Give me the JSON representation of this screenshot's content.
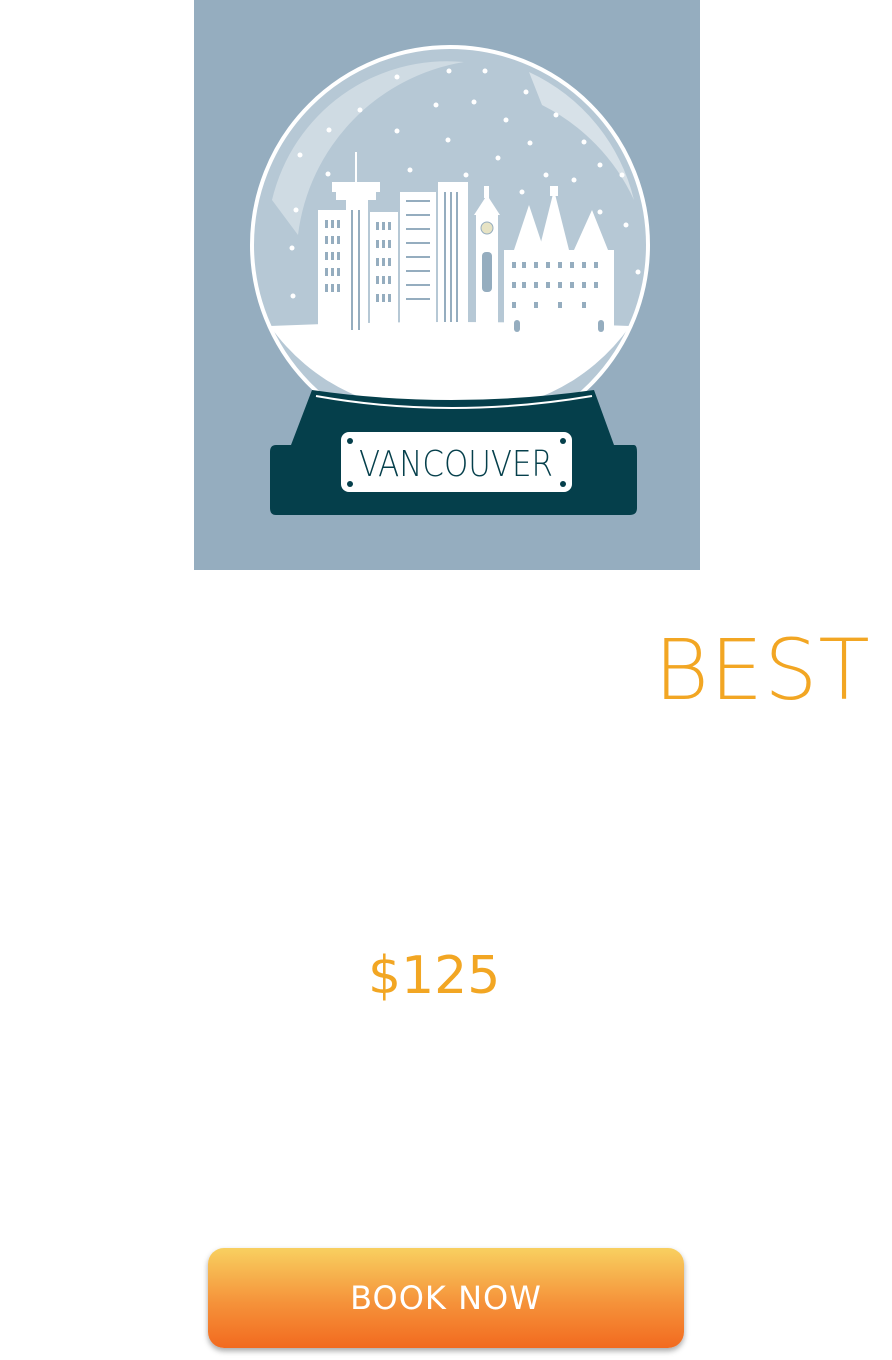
{
  "hero": {
    "plaque_text": "VANCOUVER",
    "colors": {
      "background": "#95adbf",
      "globe_base": "#053f4b",
      "snow": "#ffffff"
    }
  },
  "badge": {
    "text": "BEST"
  },
  "price": {
    "text": "$125"
  },
  "cta": {
    "label": "BOOK NOW"
  },
  "colors": {
    "accent": "#f2a623",
    "button_top": "#f8d060",
    "button_bottom": "#f26a1f"
  }
}
